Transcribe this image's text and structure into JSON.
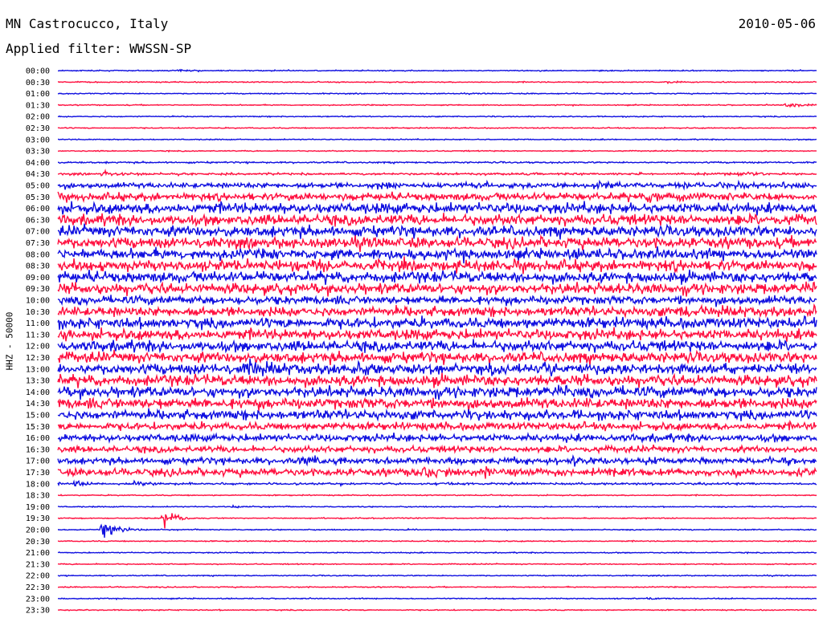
{
  "header": {
    "station": "MN Castrocucco, Italy",
    "date": "2010-05-06",
    "filter": "Applied filter: WWSSN-SP"
  },
  "chart_data": {
    "type": "line",
    "title": "MN Castrocucco, Italy",
    "ylabel": "HHZ - 50000",
    "series_colors": [
      "#1010e0",
      "#ff1040"
    ],
    "rows": [
      {
        "time": "00:00",
        "amp": 1,
        "events": [
          {
            "pos": 0.16,
            "amp": 2
          }
        ]
      },
      {
        "time": "00:30",
        "amp": 1,
        "events": [
          {
            "pos": 0.8,
            "amp": 2
          }
        ]
      },
      {
        "time": "01:00",
        "amp": 1,
        "events": []
      },
      {
        "time": "01:30",
        "amp": 1,
        "events": [
          {
            "pos": 0.96,
            "amp": 8
          }
        ]
      },
      {
        "time": "02:00",
        "amp": 1,
        "events": []
      },
      {
        "time": "02:30",
        "amp": 1,
        "events": []
      },
      {
        "time": "03:00",
        "amp": 1,
        "events": []
      },
      {
        "time": "03:30",
        "amp": 1,
        "events": []
      },
      {
        "time": "04:00",
        "amp": 1.5,
        "events": []
      },
      {
        "time": "04:30",
        "amp": 2,
        "events": [
          {
            "pos": 0.06,
            "amp": 5
          },
          {
            "pos": 0.9,
            "amp": 5
          }
        ]
      },
      {
        "time": "05:00",
        "amp": 5,
        "events": [
          {
            "pos": 0.42,
            "amp": 8
          },
          {
            "pos": 0.71,
            "amp": 10
          }
        ]
      },
      {
        "time": "05:30",
        "amp": 7,
        "events": [
          {
            "pos": 0.78,
            "amp": 12
          }
        ]
      },
      {
        "time": "06:00",
        "amp": 10,
        "events": []
      },
      {
        "time": "06:30",
        "amp": 10,
        "events": []
      },
      {
        "time": "07:00",
        "amp": 10,
        "events": []
      },
      {
        "time": "07:30",
        "amp": 10,
        "events": []
      },
      {
        "time": "08:00",
        "amp": 10,
        "events": []
      },
      {
        "time": "08:30",
        "amp": 10,
        "events": []
      },
      {
        "time": "09:00",
        "amp": 10,
        "events": []
      },
      {
        "time": "09:30",
        "amp": 10,
        "events": []
      },
      {
        "time": "10:00",
        "amp": 8,
        "events": []
      },
      {
        "time": "10:30",
        "amp": 9,
        "events": [
          {
            "pos": 0.82,
            "amp": 12
          }
        ]
      },
      {
        "time": "11:00",
        "amp": 10,
        "events": []
      },
      {
        "time": "11:30",
        "amp": 10,
        "events": []
      },
      {
        "time": "12:00",
        "amp": 10,
        "events": []
      },
      {
        "time": "12:30",
        "amp": 10,
        "events": []
      },
      {
        "time": "13:00",
        "amp": 10,
        "events": [
          {
            "pos": 0.25,
            "amp": 14
          }
        ]
      },
      {
        "time": "13:30",
        "amp": 10,
        "events": []
      },
      {
        "time": "14:00",
        "amp": 10,
        "events": []
      },
      {
        "time": "14:30",
        "amp": 10,
        "events": []
      },
      {
        "time": "15:00",
        "amp": 9,
        "events": []
      },
      {
        "time": "15:30",
        "amp": 7,
        "events": []
      },
      {
        "time": "16:00",
        "amp": 7,
        "events": []
      },
      {
        "time": "16:30",
        "amp": 6,
        "events": []
      },
      {
        "time": "17:00",
        "amp": 6,
        "events": [
          {
            "pos": 0.32,
            "amp": 10
          },
          {
            "pos": 0.68,
            "amp": 9
          }
        ]
      },
      {
        "time": "17:30",
        "amp": 7,
        "events": [
          {
            "pos": 0.48,
            "amp": 11
          },
          {
            "pos": 0.56,
            "amp": 11
          }
        ]
      },
      {
        "time": "18:00",
        "amp": 2,
        "events": [
          {
            "pos": 0.02,
            "amp": 7
          },
          {
            "pos": 0.1,
            "amp": 6
          }
        ]
      },
      {
        "time": "18:30",
        "amp": 1,
        "events": []
      },
      {
        "time": "19:00",
        "amp": 1,
        "events": [
          {
            "pos": 0.23,
            "amp": 2
          }
        ]
      },
      {
        "time": "19:30",
        "amp": 1,
        "events": [
          {
            "pos": 0.14,
            "amp": 26
          }
        ]
      },
      {
        "time": "20:00",
        "amp": 1,
        "events": [
          {
            "pos": 0.06,
            "amp": 38
          }
        ]
      },
      {
        "time": "20:30",
        "amp": 1,
        "events": []
      },
      {
        "time": "21:00",
        "amp": 1,
        "events": []
      },
      {
        "time": "21:30",
        "amp": 1,
        "events": []
      },
      {
        "time": "22:00",
        "amp": 1,
        "events": []
      },
      {
        "time": "22:30",
        "amp": 1,
        "events": []
      },
      {
        "time": "23:00",
        "amp": 1,
        "events": [
          {
            "pos": 0.78,
            "amp": 2
          }
        ]
      },
      {
        "time": "23:30",
        "amp": 1,
        "events": []
      }
    ]
  }
}
